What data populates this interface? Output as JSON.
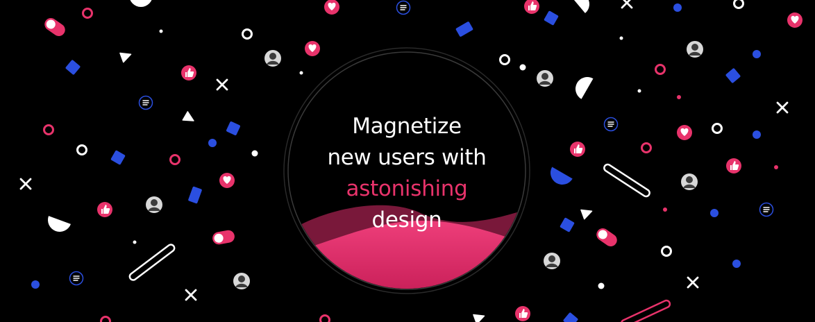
{
  "hero": {
    "line1": "Magnetize",
    "line2": "new users with",
    "line3": "astonishing",
    "line4": "design"
  },
  "colors": {
    "background": "#000000",
    "accent_pink": "#e8336b",
    "accent_blue": "#2b4fe0",
    "white": "#ffffff"
  },
  "decorations": {
    "icons": [
      "heart-badge-icon",
      "thumbs-up-badge-icon",
      "menu-badge-icon",
      "avatar-icon",
      "toggle-pill-icon",
      "ring-icon",
      "cross-icon",
      "half-circle-icon",
      "play-triangle-icon",
      "dot-icon",
      "diamond-icon",
      "capsule-outline-icon"
    ]
  }
}
